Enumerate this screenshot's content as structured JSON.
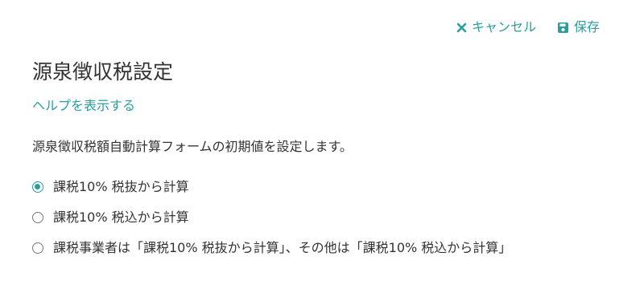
{
  "toolbar": {
    "cancel_label": "キャンセル",
    "save_label": "保存"
  },
  "page": {
    "title": "源泉徴収税設定",
    "help_link": "ヘルプを表示する",
    "description": "源泉徴収税額自動計算フォームの初期値を設定します。"
  },
  "options": [
    {
      "label": "課税10% 税抜から計算",
      "selected": true
    },
    {
      "label": "課税10% 税込から計算",
      "selected": false
    },
    {
      "label": "課税事業者は「課税10% 税抜から計算」、その他は「課税10% 税込から計算」",
      "selected": false
    }
  ],
  "colors": {
    "accent": "#2a9d9d",
    "text": "#333333"
  },
  "icons": {
    "cancel": "close-icon",
    "save": "save-icon"
  }
}
